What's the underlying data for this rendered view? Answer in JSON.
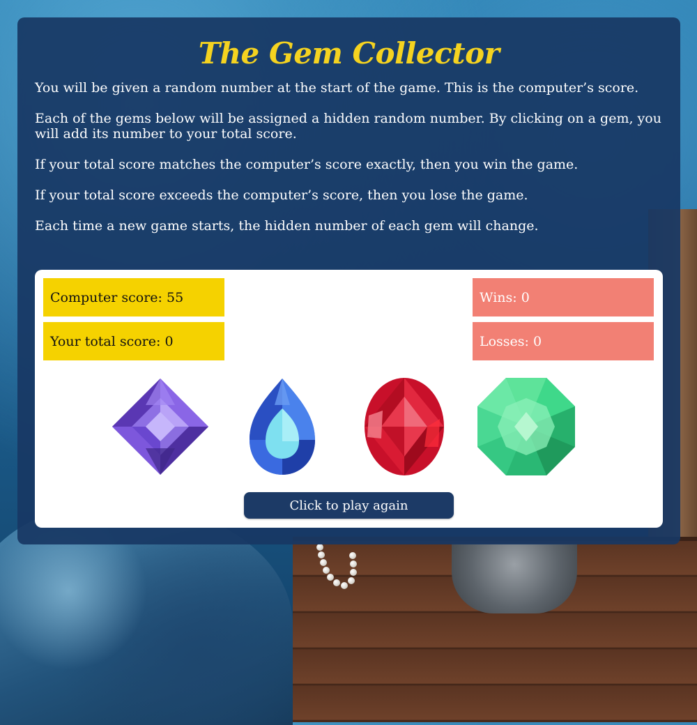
{
  "game": {
    "title": "The Gem Collector",
    "instructions": [
      "You will be given a random number at the start of the game. This is the computer’s score.",
      "Each of the gems below will be assigned a hidden random number. By clicking on a gem, you will add its number to your total score.",
      "If your total score matches the computer’s score exactly, then you win the game.",
      "If your total score exceeds the computer’s score, then you lose the game.",
      "Each time a new game starts, the hidden number of each gem will change."
    ]
  },
  "scoreboard": {
    "computer_score": "Computer score: 55",
    "total_score": "Your total score: 0",
    "wins": "Wins: 0",
    "losses": "Losses: 0"
  },
  "gems": [
    {
      "name": "purple-gem",
      "color": "#7b4fd6"
    },
    {
      "name": "blue-gem",
      "color": "#3d6fe0"
    },
    {
      "name": "red-gem",
      "color": "#d01530"
    },
    {
      "name": "green-gem",
      "color": "#3fd08a"
    }
  ],
  "actions": {
    "play_again_label": "Click to play again"
  },
  "colors": {
    "title": "#f5d320",
    "panel": "#183864",
    "score_yellow": "#f5d200",
    "score_red": "#f28074",
    "button": "#1c3a66"
  }
}
